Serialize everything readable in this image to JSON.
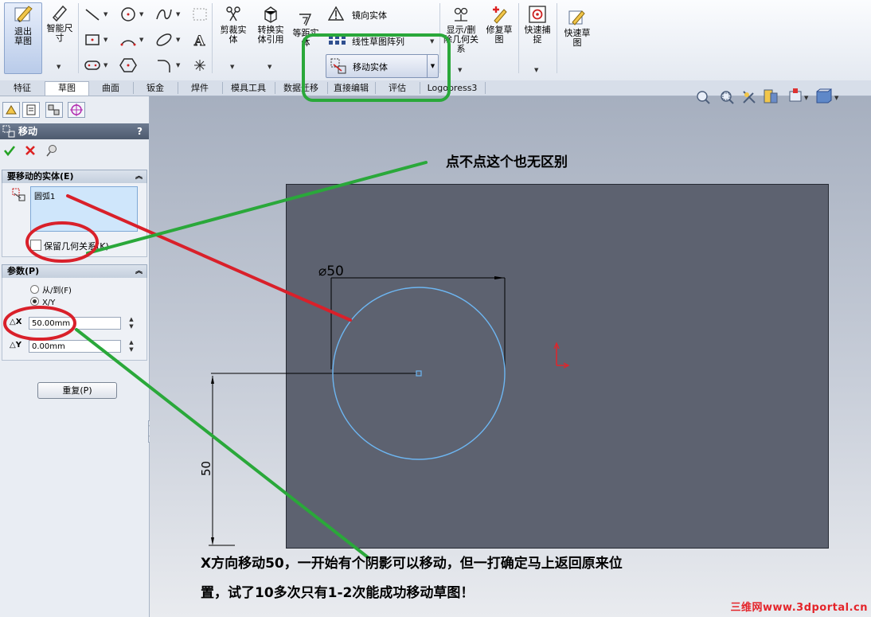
{
  "ribbon": {
    "exit_sketch": "退出草图",
    "smart_dim": "智能尺寸",
    "trim": "剪裁实体",
    "convert": "转换实体引用",
    "offset": "等距实体",
    "mirror": "镜向实体",
    "linear_pattern": "线性草图阵列",
    "move": "移动实体",
    "show_relations": "显示/删除几何关系",
    "repair": "修复草图",
    "quick_snap": "快速捕捉",
    "rapid_sketch": "快速草图"
  },
  "tabs": [
    "特征",
    "草图",
    "曲面",
    "钣金",
    "焊件",
    "模具工具",
    "数据迁移",
    "直接编辑",
    "评估",
    "Logopress3"
  ],
  "panel": {
    "title": "移动",
    "help": "?",
    "entities_header": "要移动的实体(E)",
    "entity_item": "圆弧1",
    "keep_relations": "保留几何关系(K)",
    "params_header": "参数(P)",
    "radio_from_to": "从/到(F)",
    "radio_xy": "X/Y",
    "dx_label": "X",
    "dx_value": "50.00mm",
    "dy_label": "Y",
    "dy_value": "0.00mm",
    "reset": "重复(P)"
  },
  "drawing": {
    "diameter_dim": "⌀50",
    "vertical_dim": "50"
  },
  "annotations": {
    "top": "点不点这个也无区别",
    "bottom_line1": "X方向移动50，一开始有个阴影可以移动，但一打确定马上返回原来位",
    "bottom_line2": "置，试了10多次只有1-2次能成功移动草图！"
  },
  "watermark": "三维网www.3dportal.cn",
  "colors": {
    "green_marker": "#2aa83a",
    "red_marker": "#d9202a",
    "sketch_circle": "#6db6f2",
    "sheet": "#5d6270"
  }
}
